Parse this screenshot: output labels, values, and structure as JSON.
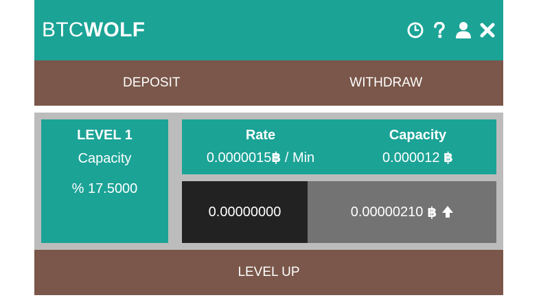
{
  "header": {
    "brand_light": "BTC",
    "brand_bold": "WOLF",
    "icons": [
      "clock-icon",
      "help-icon",
      "user-icon",
      "close-icon"
    ]
  },
  "tabs": [
    {
      "label": "DEPOSIT"
    },
    {
      "label": "WITHDRAW"
    }
  ],
  "level": {
    "title": "LEVEL 1",
    "label": "Capacity",
    "percent": "% 17.5000"
  },
  "stats": {
    "rate_header": "Rate",
    "rate_value": "0.0000015",
    "rate_unit": " / Min",
    "capacity_header": "Capacity",
    "capacity_value": "0.000012 "
  },
  "balance": {
    "value": "0.00000000"
  },
  "earning": {
    "value": "0.00000210 "
  },
  "currency_symbol": "฿",
  "level_up": {
    "label": "LEVEL UP"
  },
  "colors": {
    "teal": "#1ba396",
    "brown": "#7a574a",
    "dark": "#222222",
    "gray": "#737373",
    "panel": "#bcbcbc"
  }
}
